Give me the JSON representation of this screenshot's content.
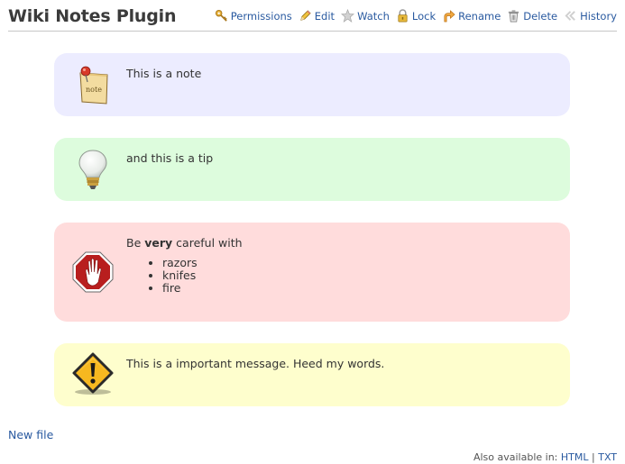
{
  "header": {
    "title": "Wiki Notes Plugin",
    "actions": [
      {
        "label": "Permissions",
        "icon": "key-icon"
      },
      {
        "label": "Edit",
        "icon": "pencil-icon"
      },
      {
        "label": "Watch",
        "icon": "star-icon"
      },
      {
        "label": "Lock",
        "icon": "lock-icon"
      },
      {
        "label": "Rename",
        "icon": "rename-arrow-icon"
      },
      {
        "label": "Delete",
        "icon": "trash-icon"
      },
      {
        "label": "History",
        "icon": "history-icon"
      }
    ]
  },
  "notes": [
    {
      "type": "note",
      "icon": "note-paper-icon",
      "color": "#ececff",
      "text": "This is a note",
      "icon_text": "note"
    },
    {
      "type": "tip",
      "icon": "lightbulb-icon",
      "color": "#ddfcdd",
      "text": "and this is a tip"
    },
    {
      "type": "caution",
      "icon": "stop-hand-icon",
      "color": "#ffdcdc",
      "text_prefix": "Be ",
      "text_bold": "very",
      "text_suffix": " careful with",
      "items": [
        "razors",
        "knifes",
        "fire"
      ]
    },
    {
      "type": "warning",
      "icon": "warning-icon",
      "color": "#fefecd",
      "text": "This is a important message. Heed my words."
    }
  ],
  "new_file_link": "New file",
  "footer": {
    "prefix": "Also available in:",
    "formats": [
      "HTML",
      "TXT"
    ],
    "separator": "|"
  }
}
